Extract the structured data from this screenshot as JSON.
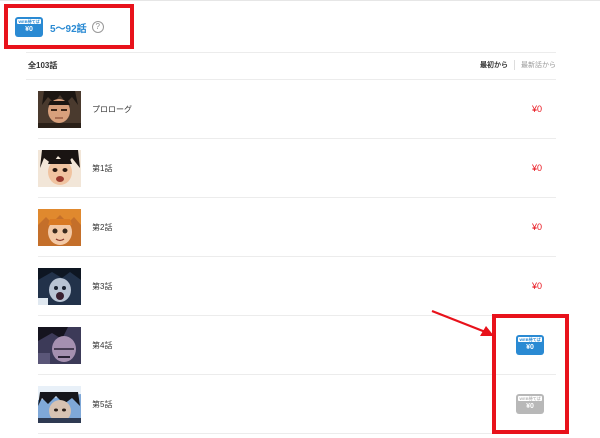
{
  "header": {
    "ticket_top": "WEB待てば",
    "ticket_price": "¥0",
    "range_text": "5～92話",
    "help_symbol": "?"
  },
  "list_header": {
    "total": "全103話",
    "sort_first": "最初から",
    "sort_newest": "最新話から"
  },
  "episodes": [
    {
      "title": "プロローグ",
      "price": "¥0",
      "kind": "price"
    },
    {
      "title": "第1話",
      "price": "¥0",
      "kind": "price"
    },
    {
      "title": "第2話",
      "price": "¥0",
      "kind": "price"
    },
    {
      "title": "第3話",
      "price": "¥0",
      "kind": "price"
    },
    {
      "title": "第4話",
      "ticket_top": "WEB待てば",
      "ticket_price": "¥0",
      "kind": "ticket-active"
    },
    {
      "title": "第5話",
      "ticket_top": "WEB待てば",
      "ticket_price": "¥0",
      "kind": "ticket-inactive"
    }
  ],
  "colors": {
    "accent_blue": "#2a8ad3",
    "price_red": "#e8121b",
    "highlight_red": "#e8121b",
    "ticket_gray": "#b8b8b8"
  }
}
